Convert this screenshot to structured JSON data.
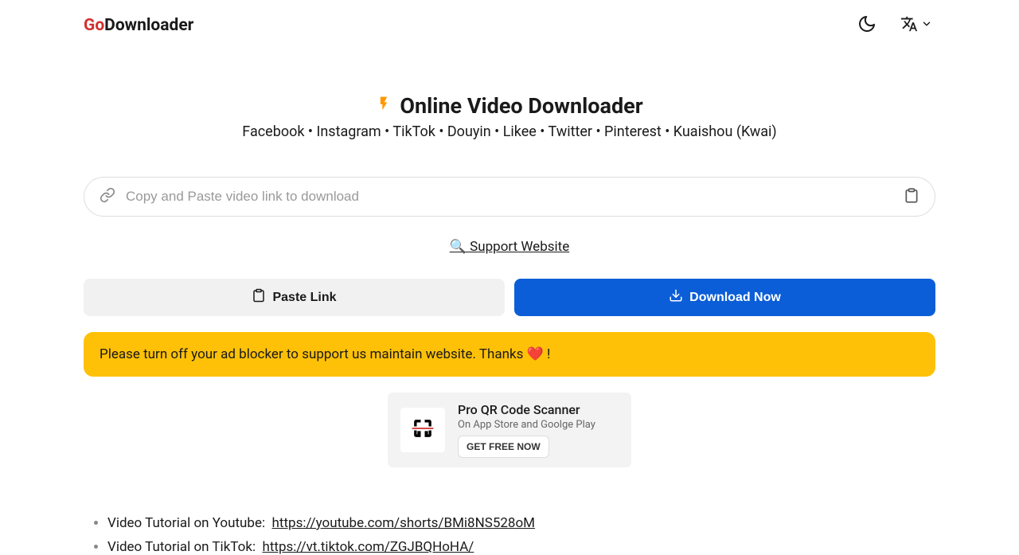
{
  "header": {
    "logo_go": "Go",
    "logo_downloader": "Downloader"
  },
  "main": {
    "title": "Online Video Downloader",
    "subtitle": "Facebook • Instagram • TikTok • Douyin • Likee • Twitter • Pinterest • Kuaishou (Kwai)",
    "input_placeholder": "Copy and Paste video link to download",
    "input_value": "",
    "support_label": "🔍  Support Website",
    "paste_label": "Paste Link",
    "download_label": "Download Now",
    "alert_text": "Please turn off your ad blocker to support us maintain website. Thanks ❤️ !"
  },
  "promo": {
    "title": "Pro QR Code Scanner",
    "subtitle": "On App Store and Goolge Play",
    "button": "GET FREE NOW"
  },
  "tutorials": [
    {
      "label": "Video Tutorial on Youtube:",
      "url": "https://youtube.com/shorts/BMi8NS528oM"
    },
    {
      "label": "Video Tutorial on TikTok:",
      "url": "https://vt.tiktok.com/ZGJBQHoHA/"
    }
  ]
}
